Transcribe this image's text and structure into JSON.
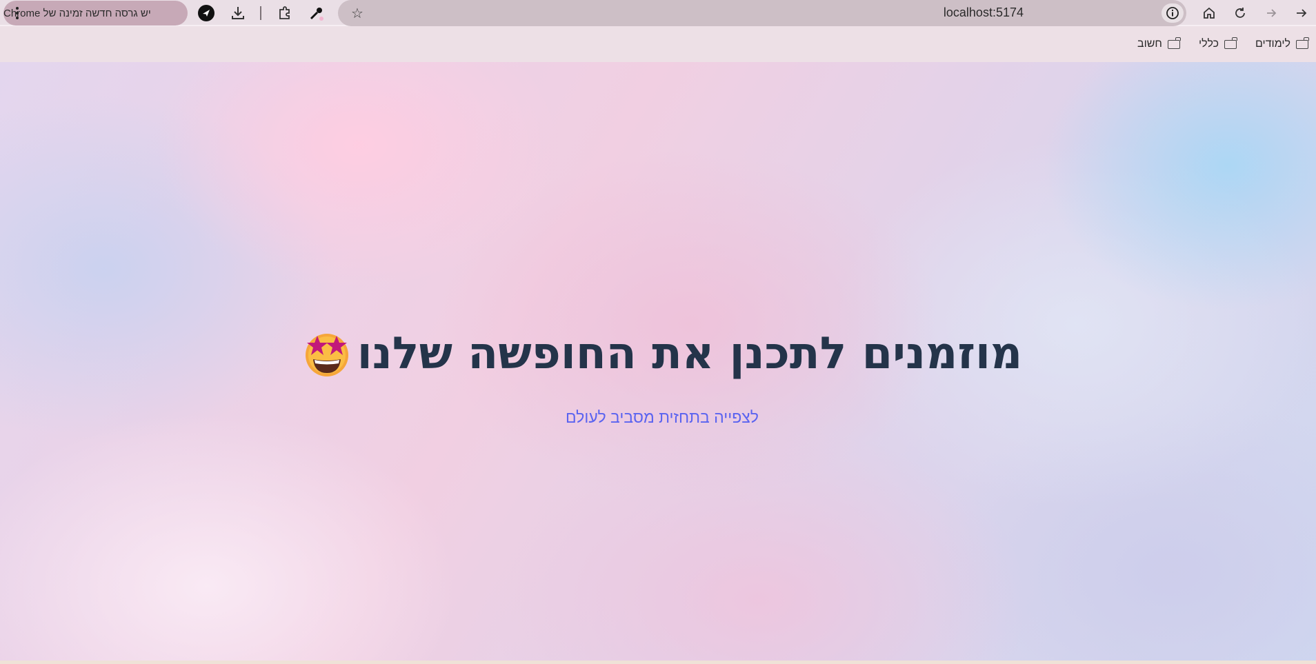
{
  "browser": {
    "address_bar": {
      "url": "localhost:5174"
    },
    "update_notice": {
      "text": "יש גרסה חדשה זמינה של Chrome"
    },
    "bookmarks": [
      {
        "label": "לימודים"
      },
      {
        "label": "כללי"
      },
      {
        "label": "חשוב"
      }
    ]
  },
  "page": {
    "headline": "מוזמנים לתכנן את החופשה שלנו",
    "subtitle_link": "לצפייה בתחזית מסביב לעולם"
  },
  "colors": {
    "headline": "#24344a",
    "link": "#5a63f0"
  }
}
